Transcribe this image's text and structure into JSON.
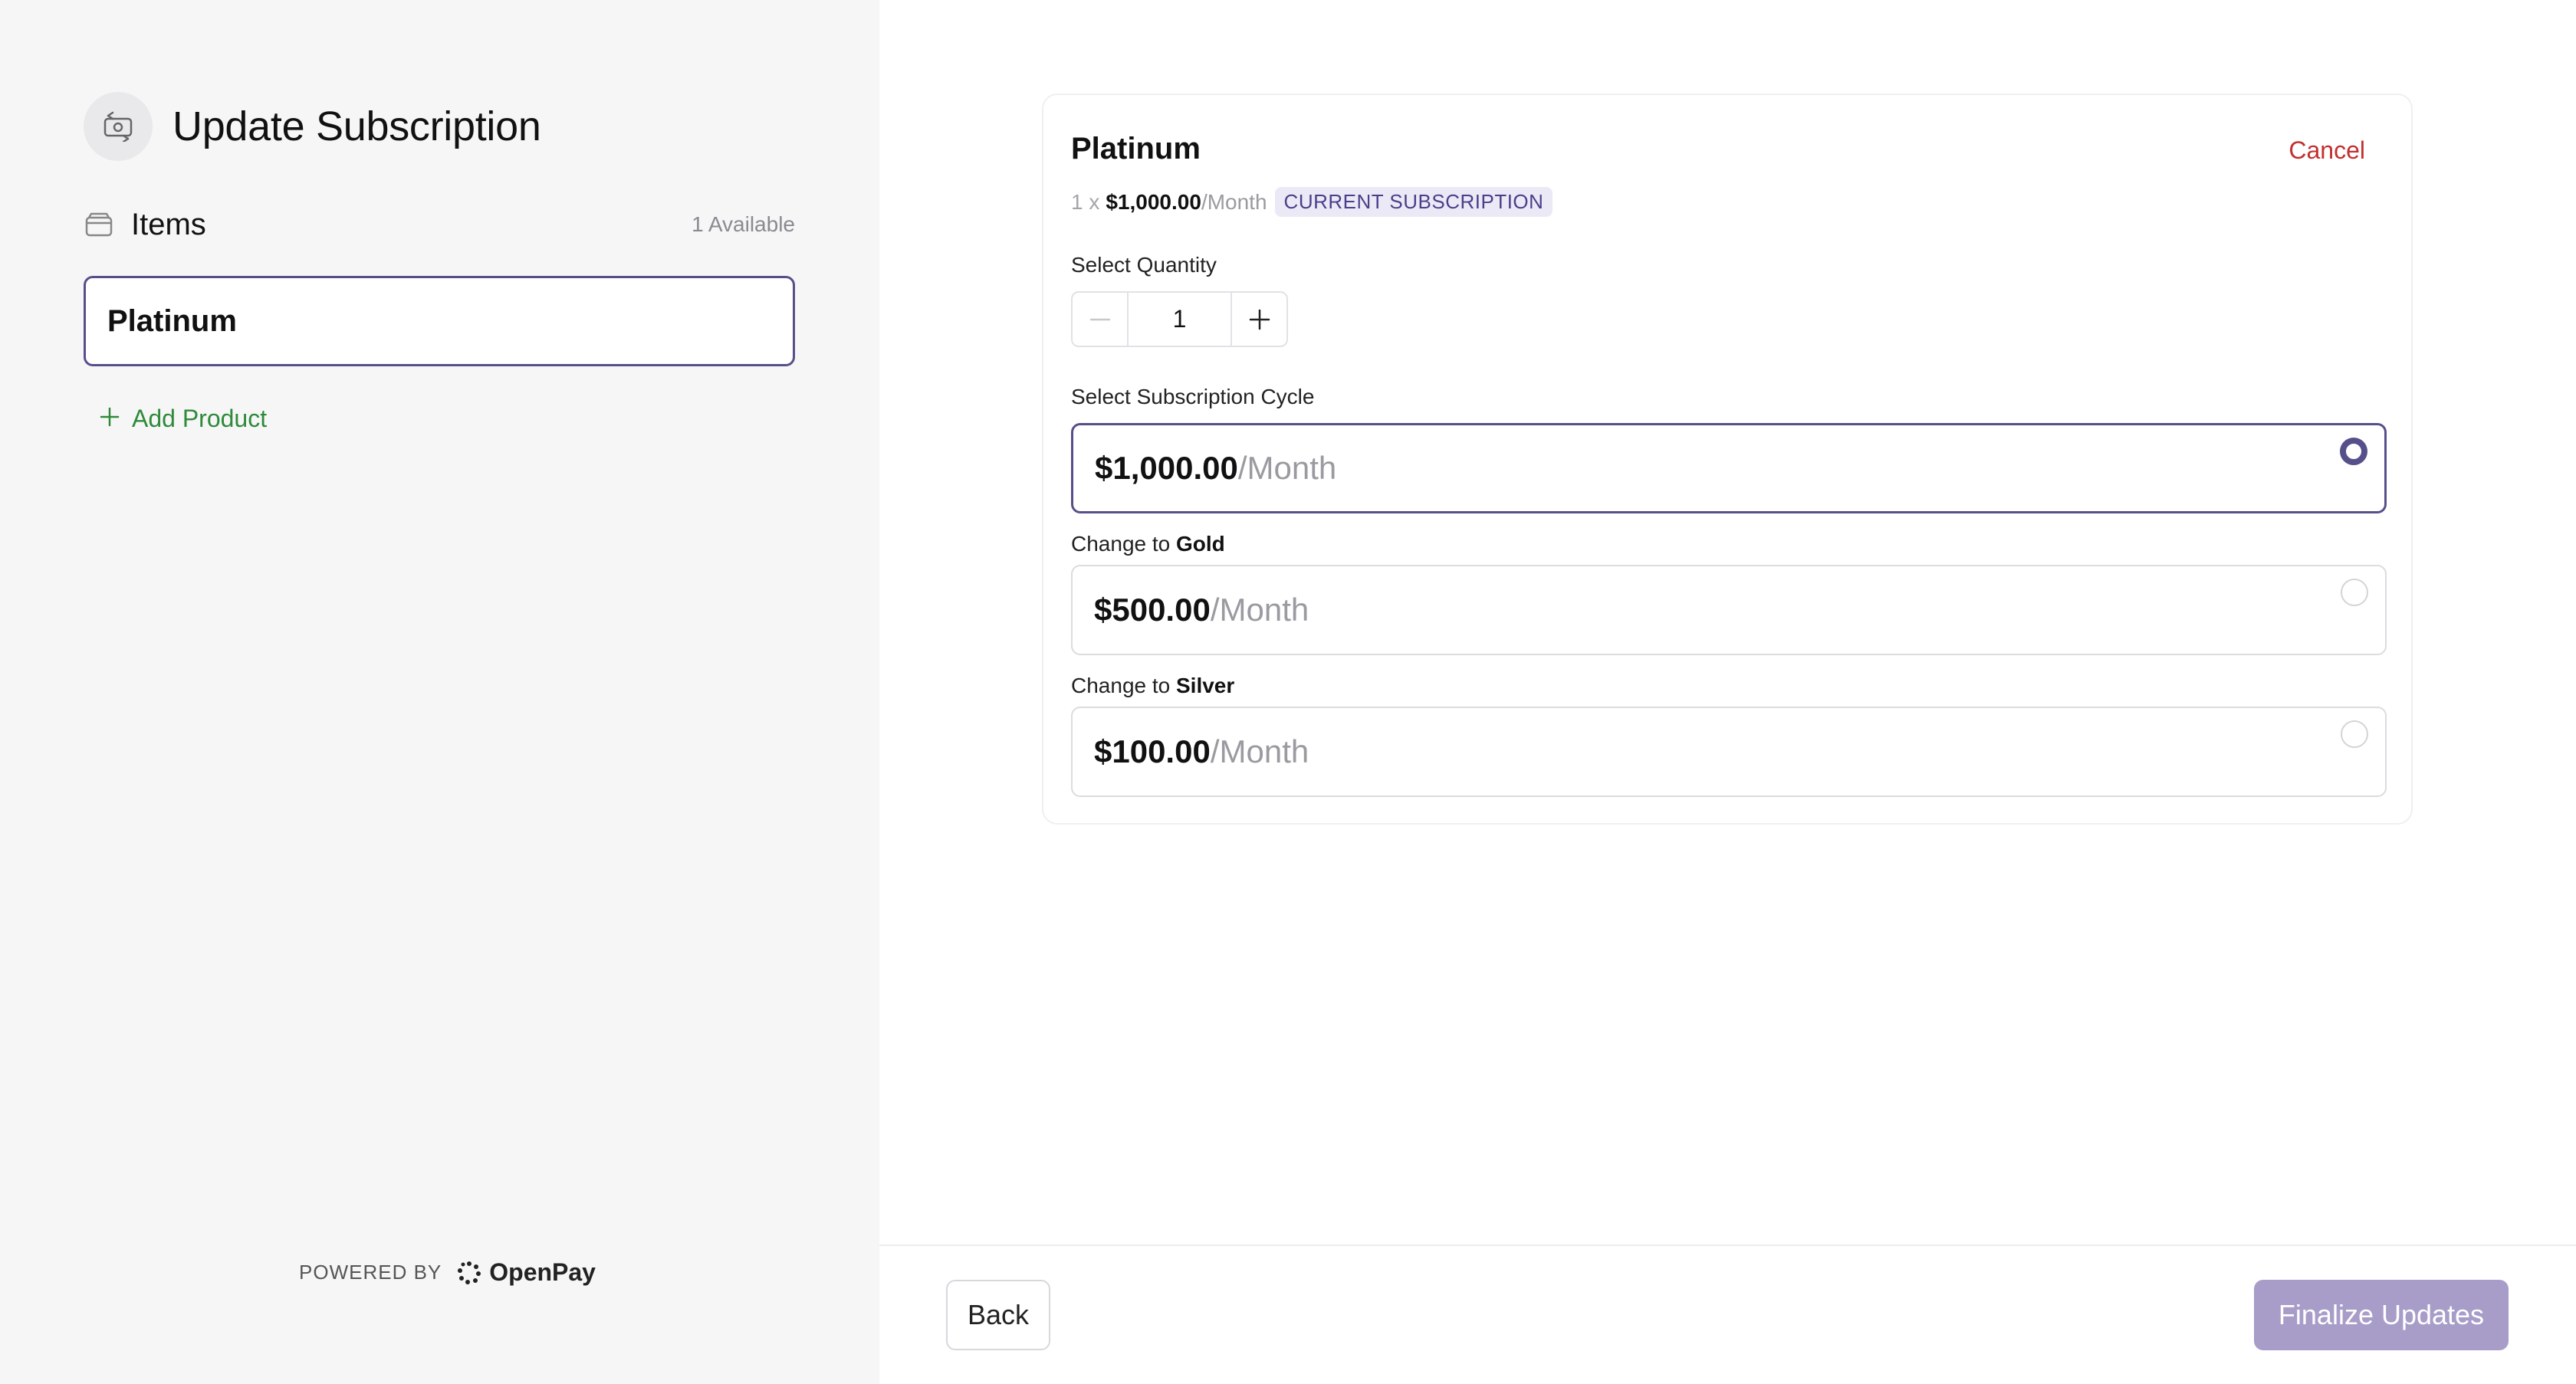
{
  "header": {
    "title": "Update Subscription",
    "icon": "subscription-swap-icon"
  },
  "items": {
    "label": "Items",
    "available": "1 Available",
    "icon": "box-icon"
  },
  "products": [
    {
      "name": "Platinum"
    }
  ],
  "add_product": {
    "label": "Add Product",
    "icon": "plus-icon"
  },
  "branding": {
    "powered_by": "POWERED BY",
    "brand": "OpenPay"
  },
  "subscription": {
    "plan": "Platinum",
    "cancel_label": "Cancel",
    "summary_qty": "1 x",
    "summary_price": "$1,000.00",
    "summary_period": "/Month",
    "badge": "CURRENT SUBSCRIPTION",
    "quantity_label": "Select Quantity",
    "quantity": "1",
    "cycle_label": "Select Subscription Cycle"
  },
  "options": [
    {
      "change_prefix": "",
      "change_plan": "",
      "price": "$1,000.00",
      "period": "/Month",
      "selected": true
    },
    {
      "change_prefix": "Change to",
      "change_plan": "Gold",
      "price": "$500.00",
      "period": "/Month",
      "selected": false
    },
    {
      "change_prefix": "Change to",
      "change_plan": "Silver",
      "price": "$100.00",
      "period": "/Month",
      "selected": false
    }
  ],
  "footer": {
    "back_label": "Back",
    "finalize_label": "Finalize Updates"
  },
  "colors": {
    "accent": "#55508a",
    "cancel": "#c23030",
    "add": "#2f8a3a",
    "finalize_disabled": "#a79dc8"
  }
}
